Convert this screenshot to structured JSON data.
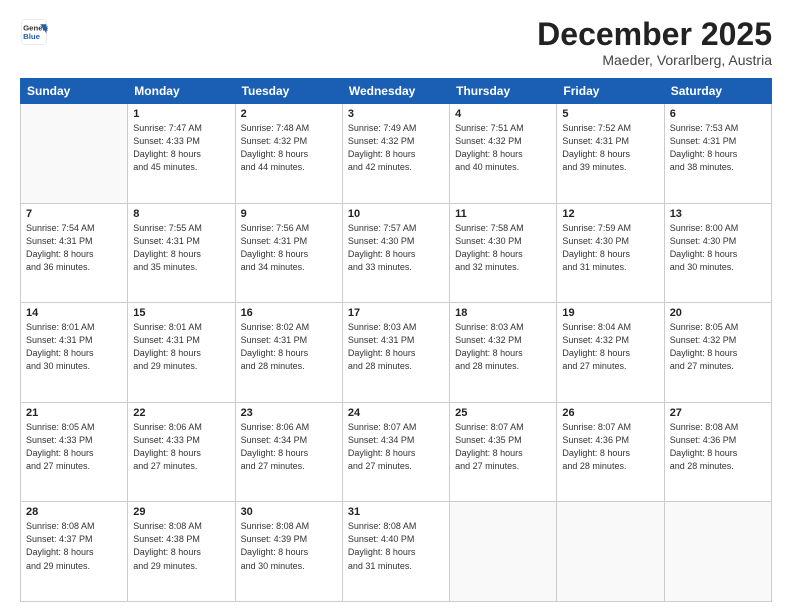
{
  "header": {
    "logo_line1": "General",
    "logo_line2": "Blue",
    "month": "December 2025",
    "location": "Maeder, Vorarlberg, Austria"
  },
  "weekdays": [
    "Sunday",
    "Monday",
    "Tuesday",
    "Wednesday",
    "Thursday",
    "Friday",
    "Saturday"
  ],
  "weeks": [
    [
      {
        "day": "",
        "info": ""
      },
      {
        "day": "1",
        "info": "Sunrise: 7:47 AM\nSunset: 4:33 PM\nDaylight: 8 hours\nand 45 minutes."
      },
      {
        "day": "2",
        "info": "Sunrise: 7:48 AM\nSunset: 4:32 PM\nDaylight: 8 hours\nand 44 minutes."
      },
      {
        "day": "3",
        "info": "Sunrise: 7:49 AM\nSunset: 4:32 PM\nDaylight: 8 hours\nand 42 minutes."
      },
      {
        "day": "4",
        "info": "Sunrise: 7:51 AM\nSunset: 4:32 PM\nDaylight: 8 hours\nand 40 minutes."
      },
      {
        "day": "5",
        "info": "Sunrise: 7:52 AM\nSunset: 4:31 PM\nDaylight: 8 hours\nand 39 minutes."
      },
      {
        "day": "6",
        "info": "Sunrise: 7:53 AM\nSunset: 4:31 PM\nDaylight: 8 hours\nand 38 minutes."
      }
    ],
    [
      {
        "day": "7",
        "info": "Sunrise: 7:54 AM\nSunset: 4:31 PM\nDaylight: 8 hours\nand 36 minutes."
      },
      {
        "day": "8",
        "info": "Sunrise: 7:55 AM\nSunset: 4:31 PM\nDaylight: 8 hours\nand 35 minutes."
      },
      {
        "day": "9",
        "info": "Sunrise: 7:56 AM\nSunset: 4:31 PM\nDaylight: 8 hours\nand 34 minutes."
      },
      {
        "day": "10",
        "info": "Sunrise: 7:57 AM\nSunset: 4:30 PM\nDaylight: 8 hours\nand 33 minutes."
      },
      {
        "day": "11",
        "info": "Sunrise: 7:58 AM\nSunset: 4:30 PM\nDaylight: 8 hours\nand 32 minutes."
      },
      {
        "day": "12",
        "info": "Sunrise: 7:59 AM\nSunset: 4:30 PM\nDaylight: 8 hours\nand 31 minutes."
      },
      {
        "day": "13",
        "info": "Sunrise: 8:00 AM\nSunset: 4:30 PM\nDaylight: 8 hours\nand 30 minutes."
      }
    ],
    [
      {
        "day": "14",
        "info": "Sunrise: 8:01 AM\nSunset: 4:31 PM\nDaylight: 8 hours\nand 30 minutes."
      },
      {
        "day": "15",
        "info": "Sunrise: 8:01 AM\nSunset: 4:31 PM\nDaylight: 8 hours\nand 29 minutes."
      },
      {
        "day": "16",
        "info": "Sunrise: 8:02 AM\nSunset: 4:31 PM\nDaylight: 8 hours\nand 28 minutes."
      },
      {
        "day": "17",
        "info": "Sunrise: 8:03 AM\nSunset: 4:31 PM\nDaylight: 8 hours\nand 28 minutes."
      },
      {
        "day": "18",
        "info": "Sunrise: 8:03 AM\nSunset: 4:32 PM\nDaylight: 8 hours\nand 28 minutes."
      },
      {
        "day": "19",
        "info": "Sunrise: 8:04 AM\nSunset: 4:32 PM\nDaylight: 8 hours\nand 27 minutes."
      },
      {
        "day": "20",
        "info": "Sunrise: 8:05 AM\nSunset: 4:32 PM\nDaylight: 8 hours\nand 27 minutes."
      }
    ],
    [
      {
        "day": "21",
        "info": "Sunrise: 8:05 AM\nSunset: 4:33 PM\nDaylight: 8 hours\nand 27 minutes."
      },
      {
        "day": "22",
        "info": "Sunrise: 8:06 AM\nSunset: 4:33 PM\nDaylight: 8 hours\nand 27 minutes."
      },
      {
        "day": "23",
        "info": "Sunrise: 8:06 AM\nSunset: 4:34 PM\nDaylight: 8 hours\nand 27 minutes."
      },
      {
        "day": "24",
        "info": "Sunrise: 8:07 AM\nSunset: 4:34 PM\nDaylight: 8 hours\nand 27 minutes."
      },
      {
        "day": "25",
        "info": "Sunrise: 8:07 AM\nSunset: 4:35 PM\nDaylight: 8 hours\nand 27 minutes."
      },
      {
        "day": "26",
        "info": "Sunrise: 8:07 AM\nSunset: 4:36 PM\nDaylight: 8 hours\nand 28 minutes."
      },
      {
        "day": "27",
        "info": "Sunrise: 8:08 AM\nSunset: 4:36 PM\nDaylight: 8 hours\nand 28 minutes."
      }
    ],
    [
      {
        "day": "28",
        "info": "Sunrise: 8:08 AM\nSunset: 4:37 PM\nDaylight: 8 hours\nand 29 minutes."
      },
      {
        "day": "29",
        "info": "Sunrise: 8:08 AM\nSunset: 4:38 PM\nDaylight: 8 hours\nand 29 minutes."
      },
      {
        "day": "30",
        "info": "Sunrise: 8:08 AM\nSunset: 4:39 PM\nDaylight: 8 hours\nand 30 minutes."
      },
      {
        "day": "31",
        "info": "Sunrise: 8:08 AM\nSunset: 4:40 PM\nDaylight: 8 hours\nand 31 minutes."
      },
      {
        "day": "",
        "info": ""
      },
      {
        "day": "",
        "info": ""
      },
      {
        "day": "",
        "info": ""
      }
    ]
  ]
}
